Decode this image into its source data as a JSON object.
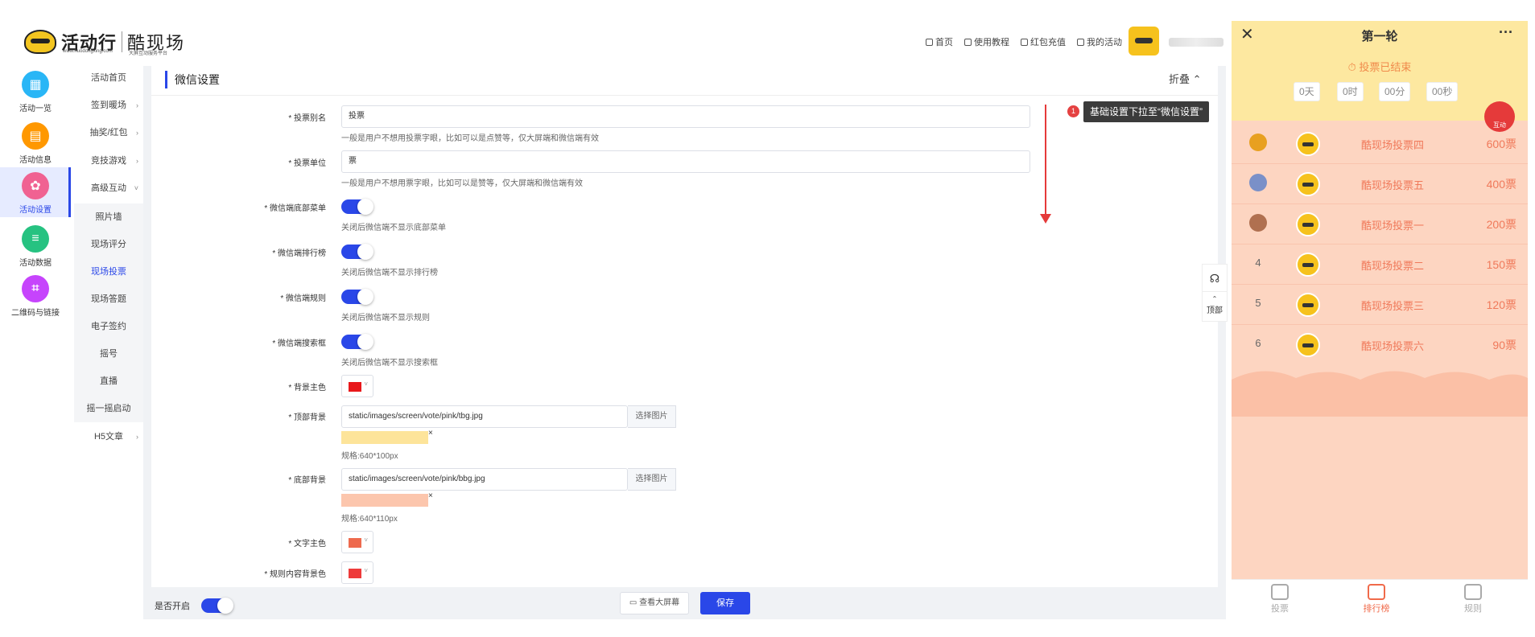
{
  "header": {
    "logo_text": "活动行",
    "logo_sub": "www.huodongxing.com",
    "brand": "酷现场",
    "brand_sub": "大屏互动服务平台",
    "nav": [
      "首页",
      "使用教程",
      "红包充值",
      "我的活动"
    ]
  },
  "icon_nav": [
    {
      "label": "活动一览",
      "color": "#29b6f6",
      "icon": "grid-icon"
    },
    {
      "label": "活动信息",
      "color": "#ff9800",
      "icon": "document-icon"
    },
    {
      "label": "活动设置",
      "color": "#f06292",
      "icon": "gear-icon",
      "active": true
    },
    {
      "label": "活动数据",
      "color": "#26c281",
      "icon": "database-icon"
    },
    {
      "label": "二维码与链接",
      "color": "#c644fc",
      "icon": "qrcode-icon"
    }
  ],
  "sub_nav": [
    {
      "label": "活动首页"
    },
    {
      "label": "签到暖场",
      "arrow": "›"
    },
    {
      "label": "抽奖/红包",
      "arrow": "›"
    },
    {
      "label": "竞技游戏",
      "arrow": "›"
    },
    {
      "label": "高级互动",
      "arrow": "˅"
    },
    {
      "label": "照片墙",
      "sub": true
    },
    {
      "label": "现场评分",
      "sub": true
    },
    {
      "label": "现场投票",
      "sub": true,
      "active": true
    },
    {
      "label": "现场答题",
      "sub": true
    },
    {
      "label": "电子签约",
      "sub": true
    },
    {
      "label": "摇号",
      "sub": true
    },
    {
      "label": "直播",
      "sub": true
    },
    {
      "label": "摇一摇启动",
      "sub": true
    },
    {
      "label": "H5文章",
      "arrow": "›"
    }
  ],
  "panel": {
    "title": "微信设置",
    "collapse": "折叠 ⌃"
  },
  "form": {
    "vote_alias_label": "* 投票别名",
    "vote_alias_value": "投票",
    "vote_alias_hint": "一般是用户不想用投票字眼，比如可以是点赞等，仅大屏端和微信端有效",
    "vote_unit_label": "* 投票单位",
    "vote_unit_value": "票",
    "vote_unit_hint": "一般是用户不想用票字眼，比如可以是赞等，仅大屏端和微信端有效",
    "bottom_menu_label": "* 微信端底部菜单",
    "bottom_menu_hint": "关闭后微信端不显示底部菜单",
    "ranking_label": "* 微信端排行榜",
    "ranking_hint": "关闭后微信端不显示排行榜",
    "rules_label": "* 微信端规则",
    "rules_hint": "关闭后微信端不显示规则",
    "search_label": "* 微信端搜索框",
    "search_hint": "关闭后微信端不显示搜索框",
    "bg_color_label": "* 背景主色",
    "bg_color": "#e8181b",
    "top_bg_label": "* 顶部背景",
    "top_bg_value": "static/images/screen/vote/pink/tbg.jpg",
    "top_bg_button": "选择图片",
    "top_bg_spec": "规格:640*100px",
    "bottom_bg_label": "* 底部背景",
    "bottom_bg_value": "static/images/screen/vote/pink/bbg.jpg",
    "bottom_bg_button": "选择图片",
    "bottom_bg_spec": "规格:640*110px",
    "text_color_label": "* 文字主色",
    "text_color": "#ee6a4e",
    "rules_bg_label": "* 规则内容背景色",
    "rules_bg_color": "#ee3b3b",
    "remove_mark": "×"
  },
  "tooltip": {
    "badge": "1",
    "text": "基础设置下拉至“微信设置”"
  },
  "float_tools": {
    "top_label": "顶部"
  },
  "bottom_bar": {
    "enable_label": "是否开启",
    "view_screen": "查看大屏幕",
    "save": "保存"
  },
  "phone": {
    "title": "第一轮",
    "close": "✕",
    "more": "···",
    "status": "⏱ 投票已结束",
    "countdown": [
      "0天",
      "0时",
      "00分",
      "00秒"
    ],
    "interact": "互动",
    "ranking": [
      {
        "rank": "1",
        "name": "酷现场投票四",
        "votes": "600票",
        "medal": "#e8a020"
      },
      {
        "rank": "2",
        "name": "酷现场投票五",
        "votes": "400票",
        "medal": "#7a90c8"
      },
      {
        "rank": "3",
        "name": "酷现场投票一",
        "votes": "200票",
        "medal": "#b07050"
      },
      {
        "rank": "4",
        "name": "酷现场投票二",
        "votes": "150票"
      },
      {
        "rank": "5",
        "name": "酷现场投票三",
        "votes": "120票"
      },
      {
        "rank": "6",
        "name": "酷现场投票六",
        "votes": "90票"
      }
    ],
    "tabs": [
      {
        "label": "投票"
      },
      {
        "label": "排行榜",
        "active": true
      },
      {
        "label": "规则"
      }
    ]
  }
}
